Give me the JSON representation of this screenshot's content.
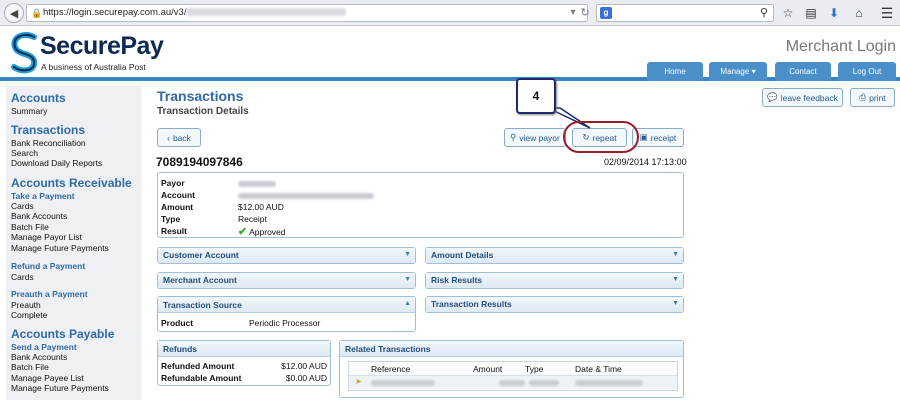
{
  "browser": {
    "url_visible": "https://login.securepay.com.au/v3/"
  },
  "header": {
    "logo_text": "SecurePay",
    "logo_subtitle": "A business of Australia Post",
    "page_heading": "Merchant Login",
    "nav": [
      {
        "label": "Home"
      },
      {
        "label": "Manage"
      },
      {
        "label": "Contact"
      },
      {
        "label": "Log Out"
      }
    ]
  },
  "sidebar": {
    "accounts": {
      "heading": "Accounts",
      "items": [
        "Summary"
      ]
    },
    "transactions": {
      "heading": "Transactions",
      "items": [
        "Bank Reconciliation",
        "Search",
        "Download Daily Reports"
      ]
    },
    "receivable": {
      "heading": "Accounts Receivable",
      "take_payment": {
        "heading": "Take a Payment",
        "items": [
          "Cards",
          "Bank Accounts",
          "Batch File",
          "Manage Payor List",
          "Manage Future Payments"
        ]
      },
      "refund": {
        "heading": "Refund a Payment",
        "items": [
          "Cards"
        ]
      },
      "preauth": {
        "heading": "Preauth a Payment",
        "items": [
          "Preauth",
          "Complete"
        ]
      }
    },
    "payable": {
      "heading": "Accounts Payable",
      "send_payment": {
        "heading": "Send a Payment",
        "items": [
          "Bank Accounts",
          "Batch File",
          "Manage Payee List",
          "Manage Future Payments"
        ]
      }
    }
  },
  "main": {
    "title": "Transactions",
    "subtitle": "Transaction Details",
    "buttons": {
      "back": "back",
      "view_payor": "view payor",
      "repeat": "repeat",
      "receipt": "receipt",
      "leave_feedback": "leave feedback",
      "print": "print"
    },
    "transaction_id": "7089194097846",
    "transaction_datetime": "02/09/2014 17:13:00",
    "summary": {
      "labels": {
        "payor": "Payor",
        "account": "Account",
        "amount": "Amount",
        "type": "Type",
        "result": "Result"
      },
      "amount": "$12.00 AUD",
      "type": "Receipt",
      "result": "Approved"
    },
    "sections": {
      "customer_account": "Customer Account",
      "amount_details": "Amount Details",
      "merchant_account": "Merchant Account",
      "risk_results": "Risk Results",
      "transaction_source": "Transaction Source",
      "transaction_results": "Transaction Results"
    },
    "transaction_source": {
      "label": "Product",
      "value": "Periodic Processor"
    },
    "refunds": {
      "heading": "Refunds",
      "refunded_label": "Refunded Amount",
      "refunded_value": "$12.00 AUD",
      "refundable_label": "Refundable Amount",
      "refundable_value": "$0.00 AUD"
    },
    "related": {
      "heading": "Related Transactions",
      "columns": [
        "Reference",
        "Amount",
        "Type",
        "Date & Time"
      ]
    }
  },
  "annotation": {
    "step_number": "4"
  }
}
